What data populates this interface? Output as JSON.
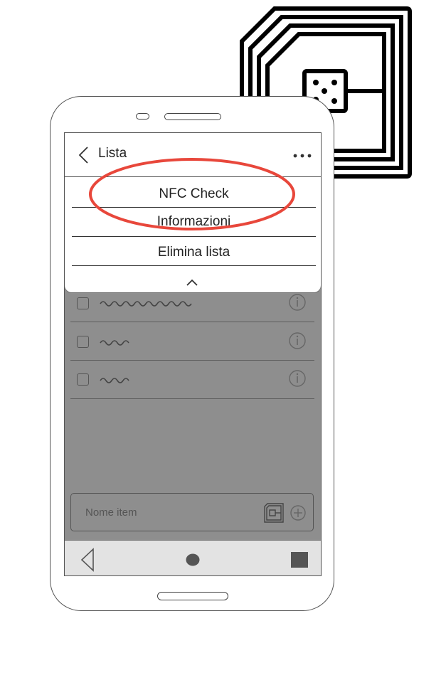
{
  "header": {
    "title": "Lista"
  },
  "menu": {
    "items": [
      {
        "label": "NFC Check"
      },
      {
        "label": "Informazioni"
      },
      {
        "label": "Elimina lista"
      }
    ]
  },
  "input": {
    "placeholder": "Nome item"
  },
  "colors": {
    "screen_dim": "#8e8e8e",
    "highlight": "#e8473b",
    "nav_bar": "#e3e3e3"
  },
  "icons": [
    "nfc-chip-icon",
    "back-chevron-icon",
    "more-dots-icon",
    "chevron-up-icon",
    "info-icon",
    "nfc-icon",
    "add-icon",
    "nav-back-icon",
    "nav-home-icon",
    "nav-recent-icon"
  ]
}
